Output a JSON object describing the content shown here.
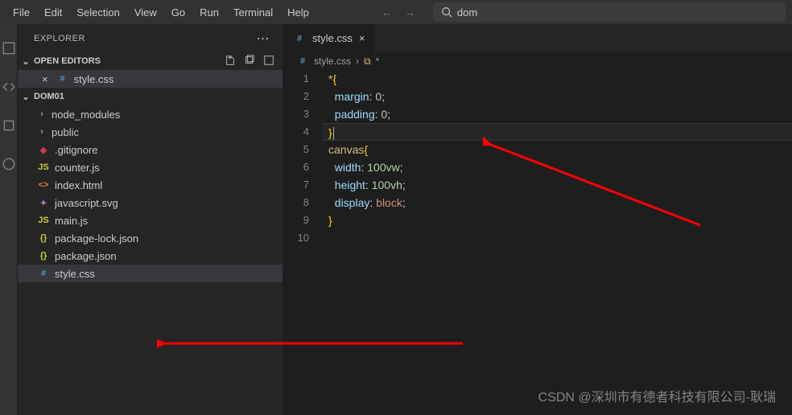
{
  "menu": {
    "items": [
      "File",
      "Edit",
      "Selection",
      "View",
      "Go",
      "Run",
      "Terminal",
      "Help"
    ]
  },
  "search": {
    "value": "dom"
  },
  "explorer": {
    "title": "EXPLORER",
    "sections": {
      "openEditors": {
        "label": "OPEN EDITORS",
        "items": [
          {
            "name": "style.css",
            "icon": "hash"
          }
        ]
      },
      "folder": {
        "label": "DOM01",
        "items": [
          {
            "name": "node_modules",
            "type": "folder"
          },
          {
            "name": "public",
            "type": "folder"
          },
          {
            "name": ".gitignore",
            "type": "file",
            "icon": "git"
          },
          {
            "name": "counter.js",
            "type": "file",
            "icon": "js"
          },
          {
            "name": "index.html",
            "type": "file",
            "icon": "html"
          },
          {
            "name": "javascript.svg",
            "type": "file",
            "icon": "svg"
          },
          {
            "name": "main.js",
            "type": "file",
            "icon": "js"
          },
          {
            "name": "package-lock.json",
            "type": "file",
            "icon": "json"
          },
          {
            "name": "package.json",
            "type": "file",
            "icon": "json"
          },
          {
            "name": "style.css",
            "type": "file",
            "icon": "hash",
            "selected": true
          }
        ]
      }
    }
  },
  "editor": {
    "tab": {
      "name": "style.css"
    },
    "breadcrumb": {
      "file": "style.css",
      "symbol": "*"
    },
    "lineNumbers": [
      "1",
      "2",
      "3",
      "4",
      "5",
      "6",
      "7",
      "8",
      "9",
      "10"
    ],
    "code": {
      "l1": {
        "a": "*",
        "b": "{"
      },
      "l2": {
        "a": "margin",
        "b": ":",
        "c": " 0",
        "d": ";"
      },
      "l3": {
        "a": "padding",
        "b": ":",
        "c": " 0",
        "d": ";"
      },
      "l4": {
        "a": "}"
      },
      "l5": {
        "a": "canvas",
        "b": "{"
      },
      "l6": {
        "a": "width",
        "b": ":",
        "c": " 100vw",
        "d": ";"
      },
      "l7": {
        "a": "height",
        "b": ":",
        "c": " 100vh",
        "d": ";"
      },
      "l8": {
        "a": "display",
        "b": ":",
        "c": " block",
        "d": ";"
      },
      "l9": {
        "a": "}"
      }
    }
  },
  "watermark": "CSDN @深圳市有德者科技有限公司-耿瑞"
}
